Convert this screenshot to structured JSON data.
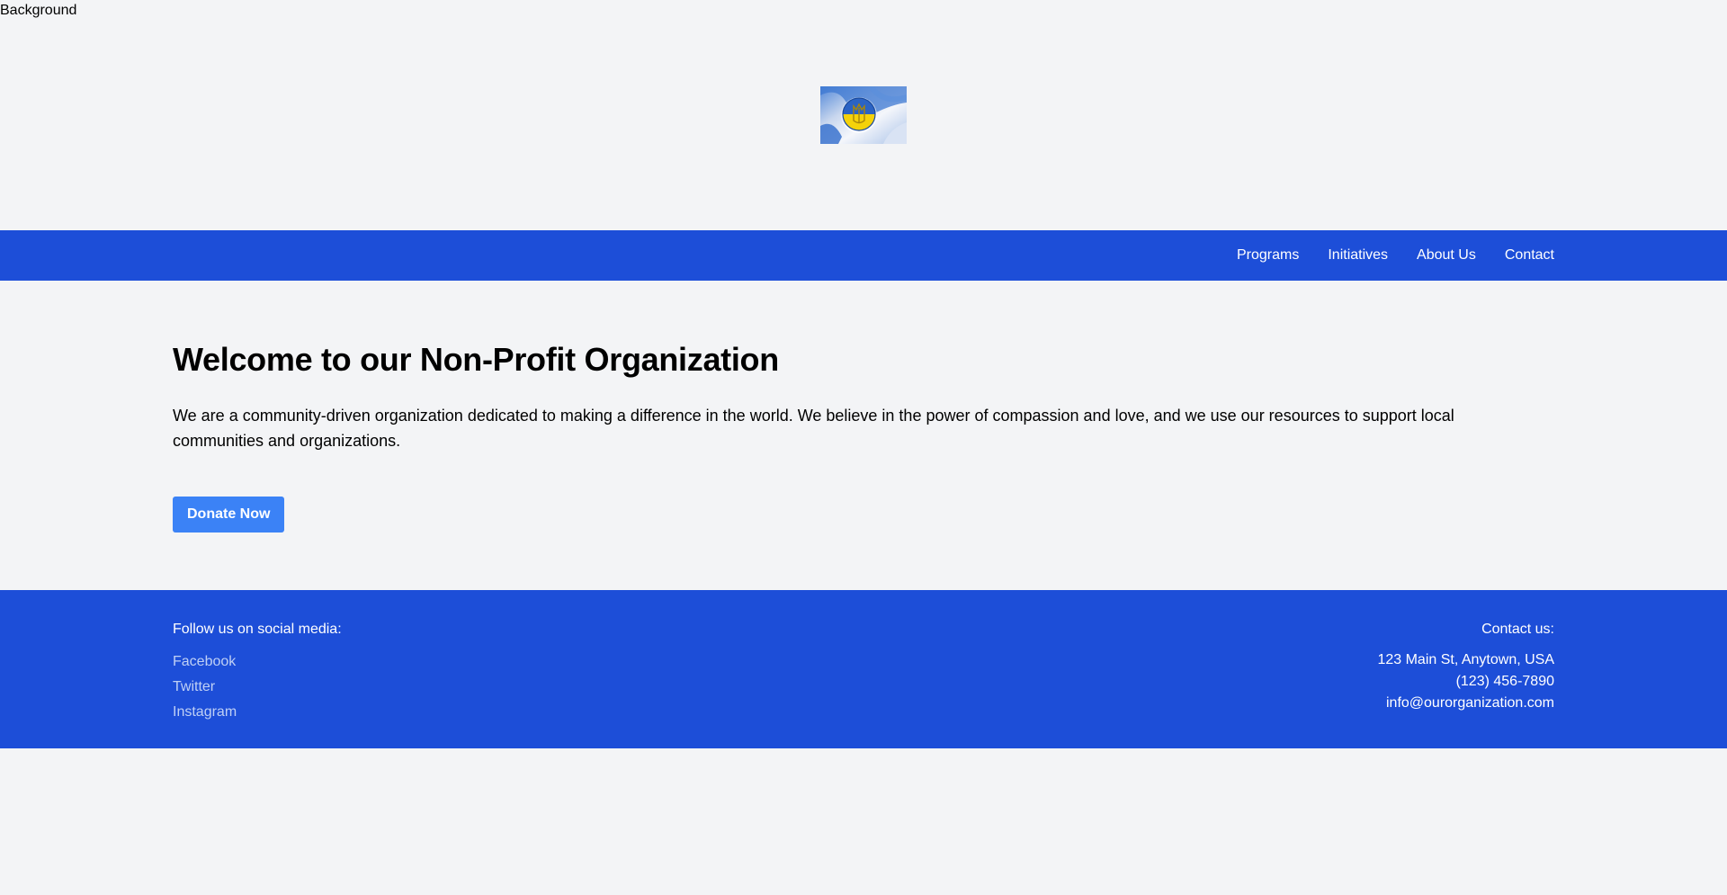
{
  "background_label": "Background",
  "logo": {
    "icon": "ukraine-flag-badge",
    "colors": {
      "blue": "#1f5fbf",
      "yellow": "#f5d20a"
    }
  },
  "nav": {
    "links": [
      {
        "label": "Programs"
      },
      {
        "label": "Initiatives"
      },
      {
        "label": "About Us"
      },
      {
        "label": "Contact"
      }
    ]
  },
  "hero": {
    "title": "Welcome to our Non-Profit Organization",
    "description": "We are a community-driven organization dedicated to making a difference in the world. We believe in the power of compassion and love, and we use our resources to support local communities and organizations.",
    "cta_label": "Donate Now"
  },
  "footer": {
    "social_heading": "Follow us on social media:",
    "social_links": [
      "Facebook",
      "Twitter",
      "Instagram"
    ],
    "contact_heading": "Contact us:",
    "address": "123 Main St, Anytown, USA",
    "phone": "(123) 456-7890",
    "email": "info@ourorganization.com"
  },
  "colors": {
    "page_bg": "#f3f4f6",
    "brand_blue": "#1d4ed8",
    "button_blue": "#3b82f6"
  }
}
